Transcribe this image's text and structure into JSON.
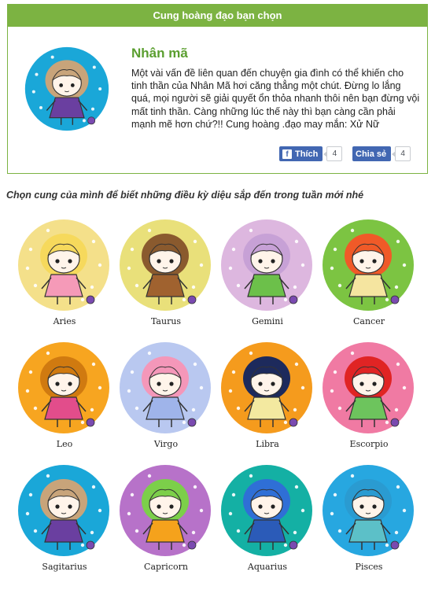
{
  "header": {
    "title": "Cung hoàng đạo bạn chọn"
  },
  "featured": {
    "name": "Nhân mã",
    "description": "Một vài vấn đề liên quan đến chuyện gia đình có thể khiến cho tinh thần của Nhân Mã hơi căng thẳng một chút. Đừng lo lắng quá, mọi người sẽ giải quyết ổn thỏa nhanh thôi nên bạn đừng vội mất tinh thần. Càng những lúc thế này thì bạn càng cần phải mạnh mẽ hơn chứ?!! Cung hoàng .đạo may mắn: Xử Nữ",
    "bg": "#1aa7d8"
  },
  "share": {
    "like_label": "Thích",
    "like_count": "4",
    "send_label": "Chia sẻ",
    "send_count": "4",
    "fb_icon": "f"
  },
  "prompt": "Chọn cung của mình để biết những điều kỳ diệu sắp đến trong tuần mới nhé",
  "zodiac": [
    {
      "label": "Aries",
      "bg": "#f4e08a",
      "hair": "#f6d95c",
      "dress": "#f59ab8"
    },
    {
      "label": "Taurus",
      "bg": "#e9e07a",
      "hair": "#8a5a2e",
      "dress": "#a0622f"
    },
    {
      "label": "Gemini",
      "bg": "#ddb7df",
      "hair": "#c7a1d6",
      "dress": "#6cc04a"
    },
    {
      "label": "Cancer",
      "bg": "#7cc442",
      "hair": "#f05a28",
      "dress": "#f5e5a0"
    },
    {
      "label": "Leo",
      "bg": "#f7a520",
      "hair": "#d07a10",
      "dress": "#e24d8b"
    },
    {
      "label": "Virgo",
      "bg": "#b9c8f0",
      "hair": "#f497b9",
      "dress": "#9fb4ea"
    },
    {
      "label": "Libra",
      "bg": "#f59b1d",
      "hair": "#1d2a5c",
      "dress": "#f3e9a0"
    },
    {
      "label": "Escorpio",
      "bg": "#f07aa3",
      "hair": "#e02424",
      "dress": "#6dc45d"
    },
    {
      "label": "Sagitarius",
      "bg": "#1aa7d8",
      "hair": "#c8a47a",
      "dress": "#6a3fa0"
    },
    {
      "label": "Capricorn",
      "bg": "#b772c9",
      "hair": "#7ccf4a",
      "dress": "#f5a21c"
    },
    {
      "label": "Aquarius",
      "bg": "#14b0a4",
      "hair": "#2f6fd6",
      "dress": "#2b5bb8"
    },
    {
      "label": "Pisces",
      "bg": "#27a7e0",
      "hair": "#2a9bd1",
      "dress": "#5cc0c8"
    }
  ]
}
